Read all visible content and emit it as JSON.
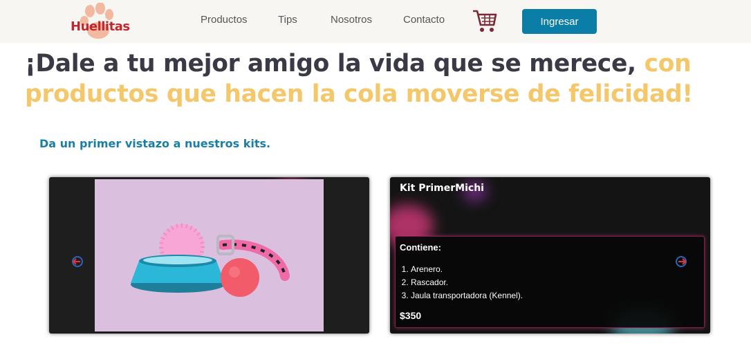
{
  "navbar": {
    "logo_text": "Huellitas",
    "links": [
      {
        "label": "Productos"
      },
      {
        "label": "Tips"
      },
      {
        "label": "Nosotros"
      },
      {
        "label": "Contacto"
      }
    ],
    "cart_icon": "shopping-cart-icon",
    "login_label": "Ingresar"
  },
  "hero": {
    "text_main": "¡Dale a tu mejor amigo la vida que se merece,",
    "text_accent_1": "con",
    "text_accent_2": "productos que hacen la cola moverse de felicidad!"
  },
  "kits": {
    "subtitle": "Da un primer vistazo a nuestros kits.",
    "title": "Kit PrimerMichi",
    "contents_heading": "Contiene:",
    "items": [
      "Arenero.",
      "Rascador.",
      "Jaula transportadora (Kennel)."
    ],
    "price": "$350",
    "prev_icon": "arrow-left-icon",
    "next_icon": "arrow-right-icon"
  },
  "colors": {
    "brand_red": "#c0282f",
    "accent_yellow": "#f5c76b",
    "primary_blue": "#0b7ea8",
    "heading_dark": "#3a3a46"
  }
}
